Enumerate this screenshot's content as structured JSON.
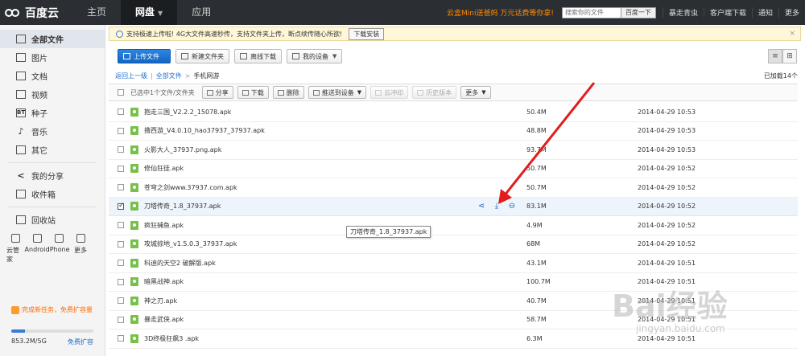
{
  "brand": {
    "logo_text": "百度云"
  },
  "topnav": {
    "items": [
      {
        "label": "主页"
      },
      {
        "label": "网盘",
        "active": true
      },
      {
        "label": "应用"
      }
    ],
    "promo": "云盒Mini送爸妈 万元话费等你拿!",
    "search_placeholder": "搜索你的文件",
    "search_button": "百度一下",
    "links": [
      "暴走青虫",
      "客户端下载",
      "通知",
      "更多"
    ]
  },
  "sidebar": {
    "items": [
      {
        "label": "全部文件",
        "icon": "folder-icon",
        "active": true
      },
      {
        "label": "图片",
        "icon": "image-icon"
      },
      {
        "label": "文档",
        "icon": "document-icon"
      },
      {
        "label": "视频",
        "icon": "video-icon"
      },
      {
        "label": "种子",
        "icon": "bt-icon",
        "glyph": "BT"
      },
      {
        "label": "音乐",
        "icon": "music-icon"
      },
      {
        "label": "其它",
        "icon": "other-icon"
      }
    ],
    "items2": [
      {
        "label": "我的分享",
        "icon": "share-icon"
      },
      {
        "label": "收件箱",
        "icon": "inbox-icon"
      }
    ],
    "items3": [
      {
        "label": "回收站",
        "icon": "trash-icon"
      }
    ],
    "devices": [
      "云管家",
      "Android",
      "iPhone",
      "更多"
    ],
    "task": "完成新任务，免费扩容量",
    "quota_text": "853.2M/5G",
    "quota_fraction": 0.17,
    "expand": "免费扩容"
  },
  "notice": {
    "text": "支持极速上传啦! 4G大文件高速秒传，支持文件夹上传，断点续传随心所欲!",
    "download": "下载安装",
    "close": "×"
  },
  "toolbar": {
    "upload": "上传文件",
    "new_folder": "新建文件夹",
    "offline": "离线下载",
    "my_devices": "我的设备"
  },
  "breadcrumb": {
    "back": "返回上一级",
    "all": "全部文件",
    "sep": ">",
    "current": "手机网游",
    "loaded": "已加载14个"
  },
  "actions": {
    "selected": "已选中1个文件/文件夹",
    "share": "分享",
    "download": "下载",
    "delete": "删除",
    "push": "推送到设备",
    "cloud": "云冲印",
    "history": "历史版本",
    "more": "更多"
  },
  "files": [
    {
      "name": "抱走三国_V2.2.2_15078.apk",
      "size": "50.4M",
      "date": "2014-04-29 10:53"
    },
    {
      "name": "撸西游_V4.0.10_hao37937_37937.apk",
      "size": "48.8M",
      "date": "2014-04-29 10:53"
    },
    {
      "name": "火影大人_37937.png.apk",
      "size": "93.7M",
      "date": "2014-04-29 10:53"
    },
    {
      "name": "修仙狂徒.apk",
      "size": "50.7M",
      "date": "2014-04-29 10:52"
    },
    {
      "name": "苍穹之剑www.37937.com.apk",
      "size": "50.7M",
      "date": "2014-04-29 10:52"
    },
    {
      "name": "刀塔传奇_1.8_37937.apk",
      "size": "83.1M",
      "date": "2014-04-29 10:52",
      "selected": true
    },
    {
      "name": "疯狂捕鱼.apk",
      "size": "4.9M",
      "date": "2014-04-29 10:52"
    },
    {
      "name": "攻城掠地_v1.5.0.3_37937.apk",
      "size": "68M",
      "date": "2014-04-29 10:52"
    },
    {
      "name": "科迪的天空2 破解版.apk",
      "size": "43.1M",
      "date": "2014-04-29 10:51"
    },
    {
      "name": "暗黑战神.apk",
      "size": "100.7M",
      "date": "2014-04-29 10:51"
    },
    {
      "name": "神之刃.apk",
      "size": "40.7M",
      "date": "2014-04-29 10:51"
    },
    {
      "name": "暴走武侠.apk",
      "size": "58.7M",
      "date": "2014-04-29 10:51"
    },
    {
      "name": "3D终极狂飙3 .apk",
      "size": "6.3M",
      "date": "2014-04-29 10:51"
    }
  ],
  "tooltip": "刀塔传奇_1.8_37937.apk",
  "watermark": {
    "main": "Bai经验",
    "sub": "jingyan.baidu.com"
  },
  "colors": {
    "accent": "#1466c2",
    "nav_bg": "#2b2f33",
    "promo": "#ff8a00",
    "arrow": "#e11d1d"
  }
}
